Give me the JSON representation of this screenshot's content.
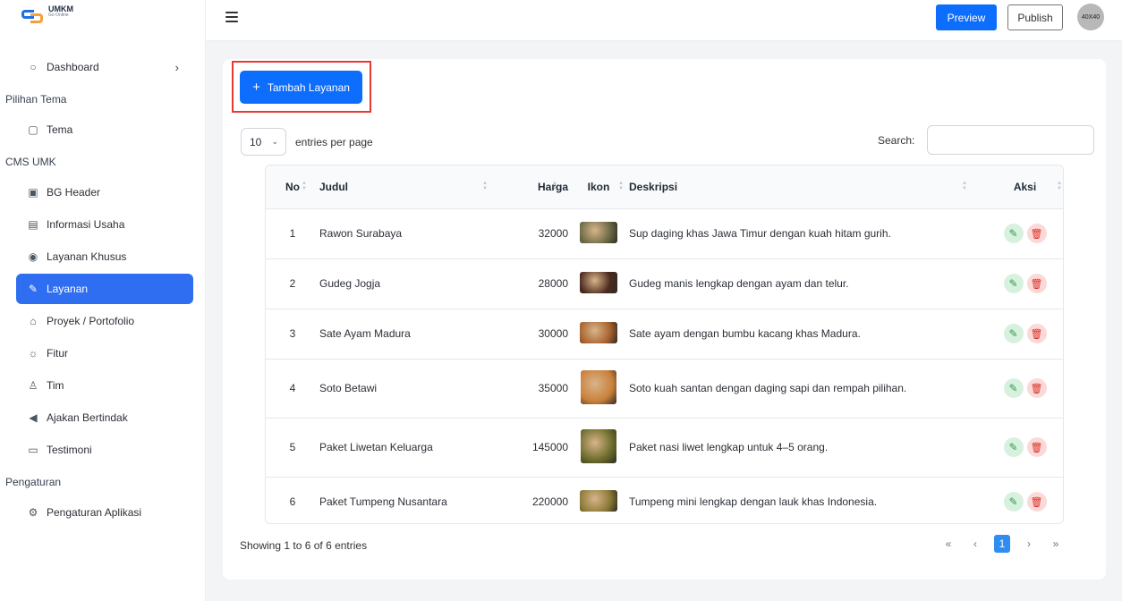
{
  "brand": {
    "logo_text": "UMKM",
    "logo_sub": "Go Online"
  },
  "topbar": {
    "preview_label": "Preview",
    "publish_label": "Publish",
    "avatar_label": "40X40"
  },
  "sidebar": {
    "items": [
      {
        "type": "item",
        "label": "Dashboard",
        "icon": "○",
        "chevron": true
      },
      {
        "type": "section",
        "label": "Pilihan Tema"
      },
      {
        "type": "item",
        "label": "Tema",
        "icon": "▢"
      },
      {
        "type": "section",
        "label": "CMS UMK"
      },
      {
        "type": "item",
        "label": "BG Header",
        "icon": "▣"
      },
      {
        "type": "item",
        "label": "Informasi Usaha",
        "icon": "▤"
      },
      {
        "type": "item",
        "label": "Layanan Khusus",
        "icon": "◉"
      },
      {
        "type": "item",
        "label": "Layanan",
        "icon": "✎",
        "active": true
      },
      {
        "type": "item",
        "label": "Proyek / Portofolio",
        "icon": "⌂"
      },
      {
        "type": "item",
        "label": "Fitur",
        "icon": "☼"
      },
      {
        "type": "item",
        "label": "Tim",
        "icon": "♙"
      },
      {
        "type": "item",
        "label": "Ajakan Bertindak",
        "icon": "◀"
      },
      {
        "type": "item",
        "label": "Testimoni",
        "icon": "▭"
      },
      {
        "type": "section",
        "label": "Pengaturan"
      },
      {
        "type": "item",
        "label": "Pengaturan Aplikasi",
        "icon": "⚙"
      }
    ]
  },
  "main": {
    "add_label": "Tambah Layanan",
    "entries_value": "10",
    "entries_label": "entries per page",
    "search_label": "Search:",
    "search_value": "",
    "columns": [
      "No",
      "Judul",
      "Harga",
      "Ikon",
      "Deskripsi",
      "Aksi"
    ],
    "rows": [
      {
        "no": "1",
        "judul": "Rawon Surabaya",
        "harga": "32000",
        "deskripsi": "Sup daging khas Jawa Timur dengan kuah hitam gurih.",
        "img_color": "#6b6a45"
      },
      {
        "no": "2",
        "judul": "Gudeg Jogja",
        "harga": "28000",
        "deskripsi": "Gudeg manis lengkap dengan ayam dan telur.",
        "img_color": "#4a2a1e"
      },
      {
        "no": "3",
        "judul": "Sate Ayam Madura",
        "harga": "30000",
        "deskripsi": "Sate ayam dengan bumbu kacang khas Madura.",
        "img_color": "#a8622e"
      },
      {
        "no": "4",
        "judul": "Soto Betawi",
        "harga": "35000",
        "deskripsi": "Soto kuah santan dengan daging sapi dan rempah pilihan.",
        "img_color": "#c9803a"
      },
      {
        "no": "5",
        "judul": "Paket Liwetan Keluarga",
        "harga": "145000",
        "deskripsi": "Paket nasi liwet lengkap untuk 4–5 orang.",
        "img_color": "#6a6b2a"
      },
      {
        "no": "6",
        "judul": "Paket Tumpeng Nusantara",
        "harga": "220000",
        "deskripsi": "Tumpeng mini lengkap dengan lauk khas Indonesia.",
        "img_color": "#8a7a36"
      }
    ],
    "footer_info": "Showing 1 to 6 of 6 entries",
    "pager": {
      "first": "«",
      "prev": "‹",
      "current": "1",
      "next": "›",
      "last": "»"
    }
  }
}
